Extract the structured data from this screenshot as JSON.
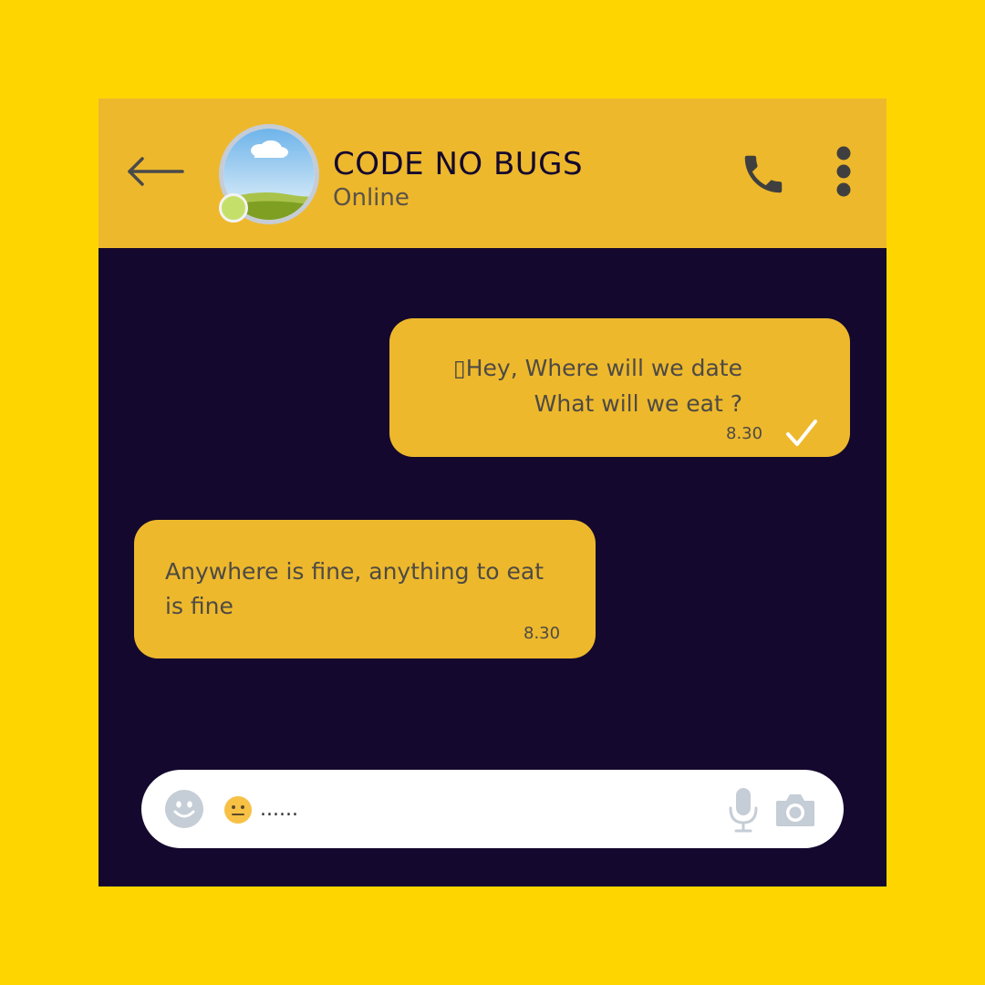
{
  "contact": {
    "name": "CODE NO BUGS",
    "status": "Online"
  },
  "header": {
    "back_icon": "arrow-left-icon",
    "call_icon": "phone-icon",
    "more_icon": "vertical-dots-icon"
  },
  "messages": [
    {
      "direction": "sent",
      "lines": [
        "▯Hey, Where will we date",
        "What will we eat  ?"
      ],
      "time": "8.30",
      "status_icon": "check-icon"
    },
    {
      "direction": "received",
      "text": "Anywhere is fine, anything to eat is fine",
      "time": "8.30"
    }
  ],
  "composer": {
    "emoji_button_icon": "smiley-icon",
    "typed_emoji": "neutral-face-emoji",
    "value": "......",
    "mic_icon": "microphone-icon",
    "camera_icon": "camera-icon"
  },
  "colors": {
    "page_background": "#FFD500",
    "header_background": "#EDB82C",
    "chat_background": "#14082E",
    "bubble_background": "#EDB82C",
    "online_indicator": "#C5E06A"
  }
}
